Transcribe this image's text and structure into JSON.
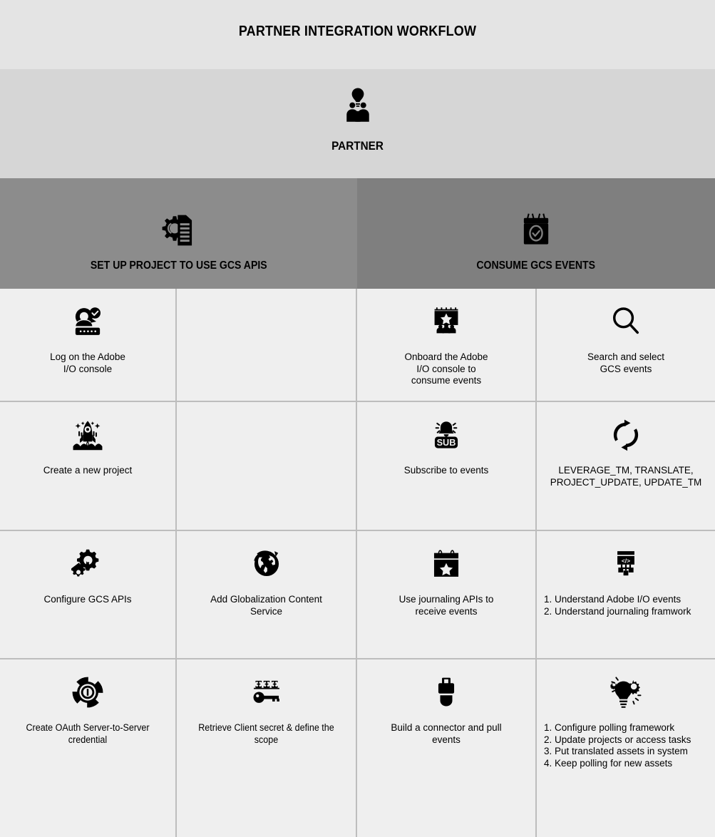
{
  "header": {
    "title": "PARTNER INTEGRATION WORKFLOW"
  },
  "actor": {
    "label": "PARTNER",
    "icon": "partner-group-idea-icon"
  },
  "colors": {
    "title_band": "#e4e4e4",
    "actor_band": "#d6d6d6",
    "section_left": "#8c8c8c",
    "section_right": "#7f7f7f",
    "cell_background": "#efefef",
    "grid_line": "#bdbdbd"
  },
  "sections": [
    {
      "label": "SET UP PROJECT TO USE GCS APIS",
      "icon": "gear-document-icon"
    },
    {
      "label": "CONSUME GCS EVENTS",
      "icon": "calendar-check-icon"
    }
  ],
  "grid": {
    "rows": [
      {
        "cells": [
          {
            "icon": "user-login-keyboard-icon",
            "text": "Log on the Adobe\nI/O console",
            "empty": false,
            "style": "plain"
          },
          {
            "icon": "",
            "text": "",
            "empty": true,
            "style": "plain"
          },
          {
            "icon": "stage-audience-star-icon",
            "text": "Onboard the Adobe\nI/O console to\nconsume events",
            "empty": false,
            "style": "plain"
          },
          {
            "icon": "magnifier-search-icon",
            "text": "Search and select\nGCS events",
            "empty": false,
            "style": "plain"
          }
        ]
      },
      {
        "cells": [
          {
            "icon": "rocket-launch-icon",
            "text": "Create a new project",
            "empty": false,
            "style": "plain"
          },
          {
            "icon": "",
            "text": "",
            "empty": true,
            "style": "plain"
          },
          {
            "icon": "bell-subscribe-icon",
            "text": "Subscribe to events",
            "empty": false,
            "style": "plain"
          },
          {
            "icon": "sync-refresh-icon",
            "text": "LEVERAGE_TM, TRANSLATE,\nPROJECT_UPDATE, UPDATE_TM",
            "empty": false,
            "style": "plain"
          }
        ]
      },
      {
        "cells": [
          {
            "icon": "gears-settings-icon",
            "text": "Configure GCS APIs",
            "empty": false,
            "style": "plain"
          },
          {
            "icon": "globe-globalization-icon",
            "text": "Add Globalization Content\nService",
            "empty": false,
            "style": "plain"
          },
          {
            "icon": "calendar-star-event-icon",
            "text": "Use journaling APIs to\nreceive events",
            "empty": false,
            "style": "plain"
          },
          {
            "icon": "code-network-icon",
            "text": "1.  Understand Adobe I/O events\n2.  Understand journaling framwork",
            "empty": false,
            "style": "list"
          }
        ]
      },
      {
        "cells": [
          {
            "icon": "oauth-badge-icon",
            "text": "Create OAuth Server-to-Server credential",
            "empty": false,
            "style": "narrow"
          },
          {
            "icon": "password-key-icon",
            "text": "Retrieve Client secret & define the scope",
            "empty": false,
            "style": "narrow"
          },
          {
            "icon": "usb-connector-icon",
            "text": "Build a connector and pull\nevents",
            "empty": false,
            "style": "plain"
          },
          {
            "icon": "lightbulb-gear-idea-icon",
            "text": "1.  Configure polling framework\n2.  Update projects or access tasks\n3.  Put translated assets in system\n4.  Keep polling for new assets",
            "empty": false,
            "style": "list"
          }
        ]
      }
    ]
  }
}
